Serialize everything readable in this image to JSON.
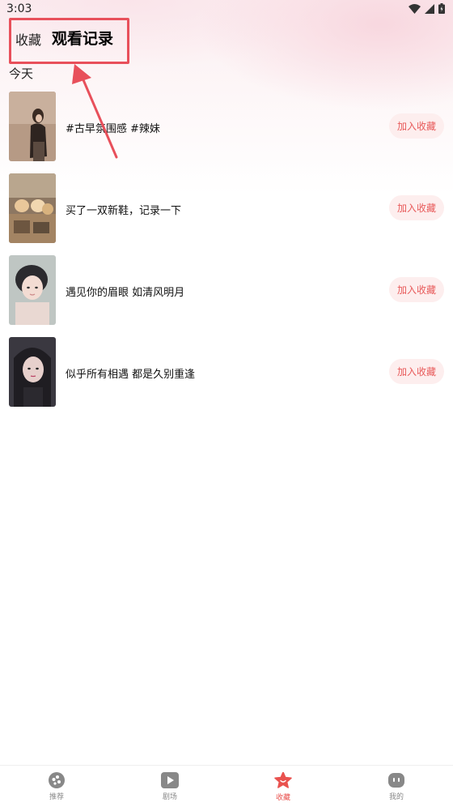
{
  "status_bar": {
    "time": "3:03"
  },
  "header": {
    "tab_collect": "收藏",
    "tab_history": "观看记录"
  },
  "section": {
    "title": "今天"
  },
  "items": [
    {
      "title": "#古早氛围感 #辣妹",
      "button": "加入收藏"
    },
    {
      "title": "买了一双新鞋，记录一下",
      "button": "加入收藏"
    },
    {
      "title": "遇见你的眉眼 如清风明月",
      "button": "加入收藏"
    },
    {
      "title": "似乎所有相遇 都是久别重逢",
      "button": "加入收藏"
    }
  ],
  "tabbar": {
    "items": [
      {
        "label": "推荐",
        "icon": "recommend-icon"
      },
      {
        "label": "剧场",
        "icon": "play-icon"
      },
      {
        "label": "收藏",
        "icon": "star-icon"
      },
      {
        "label": "我的",
        "icon": "profile-icon"
      }
    ]
  },
  "colors": {
    "accent": "#e9524f",
    "annotation": "#e8505b",
    "button_bg": "#fdeeee"
  }
}
